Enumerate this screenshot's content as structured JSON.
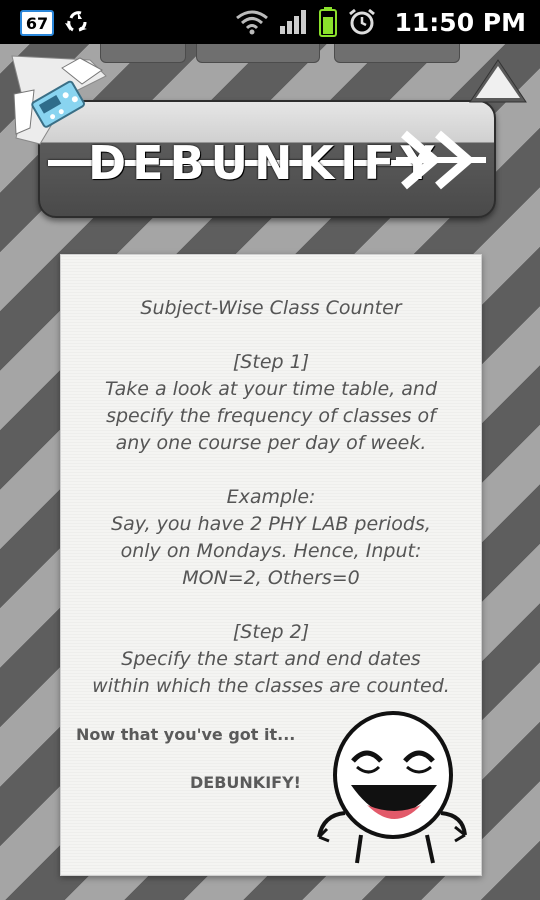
{
  "status_bar": {
    "notification_badge": "67",
    "time": "11:50 PM",
    "icons": [
      "recycle-icon",
      "wifi-icon",
      "signal-icon",
      "battery-icon",
      "alarm-icon"
    ]
  },
  "banner": {
    "title": "DEBUNKIFY"
  },
  "card": {
    "title": "Subject-Wise Class Counter",
    "step1_heading": "[Step 1]",
    "step1_lines": [
      "Take a look at your time table, and",
      "specify the frequency of classes of",
      "any one course per day of week."
    ],
    "example_heading": "Example:",
    "example_lines": [
      "Say, you have 2 PHY LAB periods,",
      "only on Mondays. Hence, Input:",
      "MON=2, Others=0"
    ],
    "step2_heading": "[Step 2]",
    "step2_lines": [
      "Specify the start and end dates",
      "within which the classes are counted."
    ],
    "footer_line1": "Now that you've got it...",
    "footer_line2": "DEBUNKIFY!"
  },
  "colors": {
    "stripe_dark": "#5e5e5e",
    "stripe_light": "#a5a5a5",
    "card_bg": "#f4f4f2",
    "text": "#555555"
  }
}
